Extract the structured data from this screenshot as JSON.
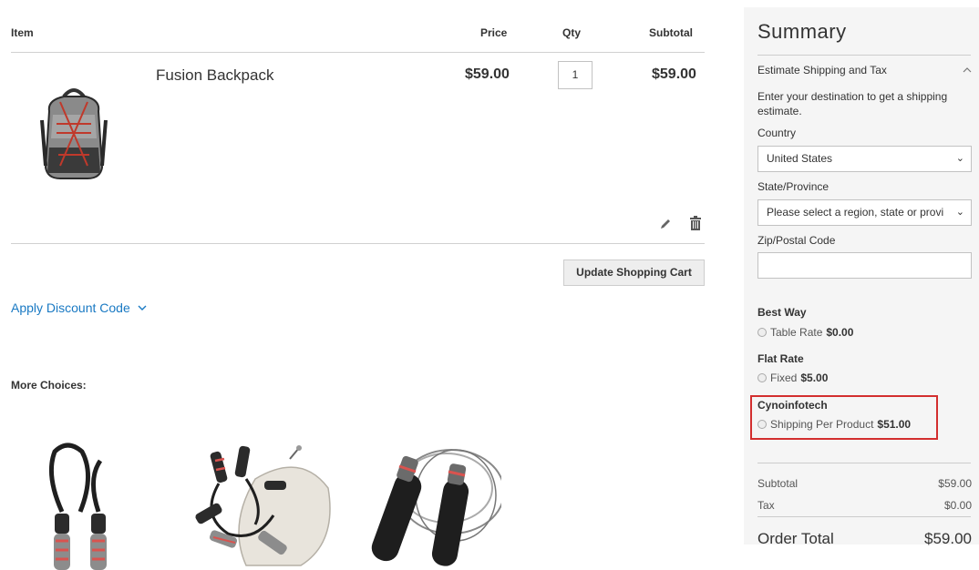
{
  "cart": {
    "headers": {
      "item": "Item",
      "price": "Price",
      "qty": "Qty",
      "subtotal": "Subtotal"
    },
    "items": [
      {
        "name": "Fusion Backpack",
        "price": "$59.00",
        "qty": "1",
        "subtotal": "$59.00"
      }
    ],
    "update_label": "Update Shopping Cart",
    "discount_label": "Apply Discount Code",
    "more_choices_label": "More Choices:"
  },
  "summary": {
    "title": "Summary",
    "estimate_title": "Estimate Shipping and Tax",
    "estimate_text": "Enter your destination to get a shipping estimate.",
    "country_label": "Country",
    "country_value": "United States",
    "state_label": "State/Province",
    "state_value": "Please select a region, state or provi",
    "zip_label": "Zip/Postal Code",
    "zip_value": "",
    "shipping_methods": [
      {
        "carrier": "Best Way",
        "method": "Table Rate",
        "price": "$0.00"
      },
      {
        "carrier": "Flat Rate",
        "method": "Fixed",
        "price": "$5.00"
      },
      {
        "carrier": "Cynoinfotech",
        "method": "Shipping Per Product",
        "price": "$51.00"
      }
    ],
    "subtotal_label": "Subtotal",
    "subtotal_value": "$59.00",
    "tax_label": "Tax",
    "tax_value": "$0.00",
    "order_total_label": "Order Total",
    "order_total_value": "$59.00"
  },
  "colors": {
    "link": "#1979c3",
    "highlight": "#d32f2f",
    "sidebar_bg": "#f5f5f5"
  },
  "icons": {
    "edit": "pencil-icon",
    "delete": "trash-icon",
    "discount_toggle": "chevron-down-icon",
    "estimate_toggle": "chevron-up-icon"
  }
}
